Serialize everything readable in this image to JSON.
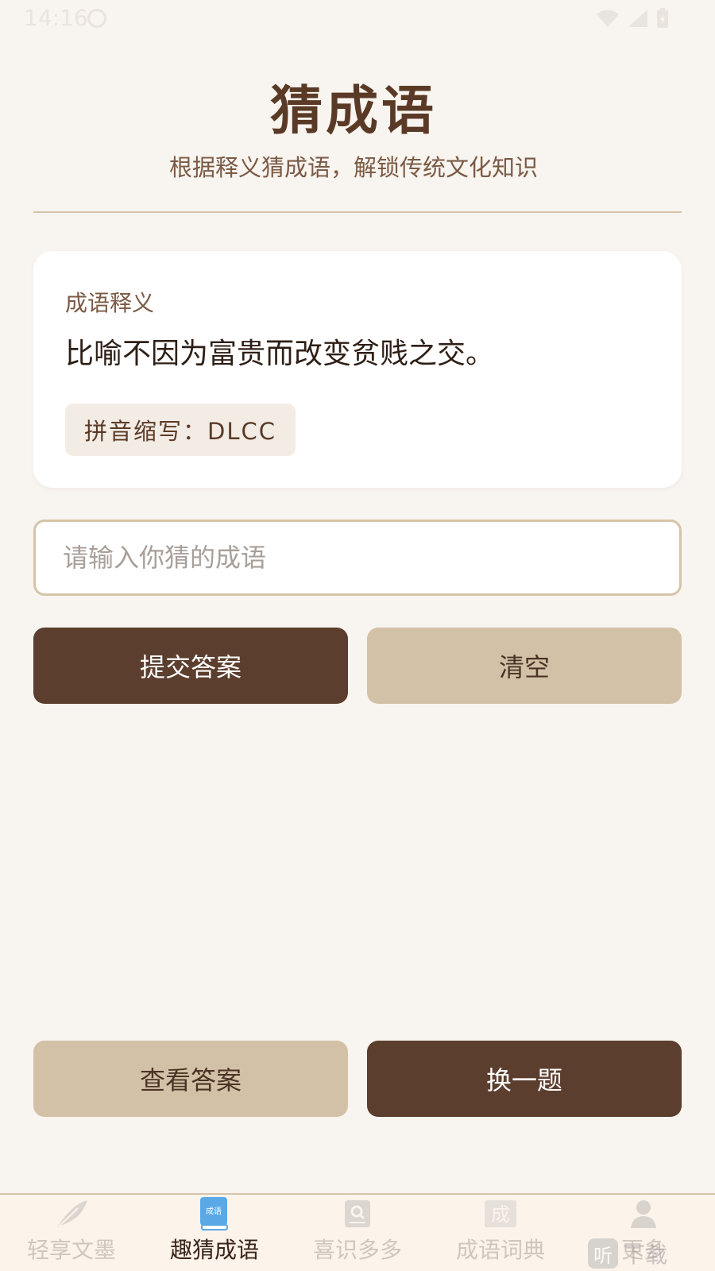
{
  "status_bar": {
    "time": "14:16"
  },
  "header": {
    "title": "猜成语",
    "subtitle": "根据释义猜成语，解锁传统文化知识"
  },
  "card": {
    "label": "成语释义",
    "definition": "比喻不因为富贵而改变贫贱之交。",
    "pinyin_hint": "拼音缩写：DLCC"
  },
  "input": {
    "placeholder": "请输入你猜的成语",
    "value": ""
  },
  "buttons": {
    "submit": "提交答案",
    "clear": "清空",
    "reveal": "查看答案",
    "next": "换一题"
  },
  "nav": {
    "items": [
      {
        "label": "轻享文墨",
        "icon": "feather-icon"
      },
      {
        "label": "趣猜成语",
        "icon": "idiom-book-icon",
        "active": true
      },
      {
        "label": "喜识多多",
        "icon": "search-book-icon"
      },
      {
        "label": "成语词典",
        "icon": "dictionary-icon"
      },
      {
        "label": "更多",
        "icon": "user-icon"
      }
    ]
  },
  "watermark": {
    "logo": "听",
    "text": "下载"
  },
  "colors": {
    "background": "#f8f4ef",
    "primary_dark": "#5c3e2e",
    "primary_light": "#d3c1a7",
    "accent_blue": "#5aa9e6"
  }
}
